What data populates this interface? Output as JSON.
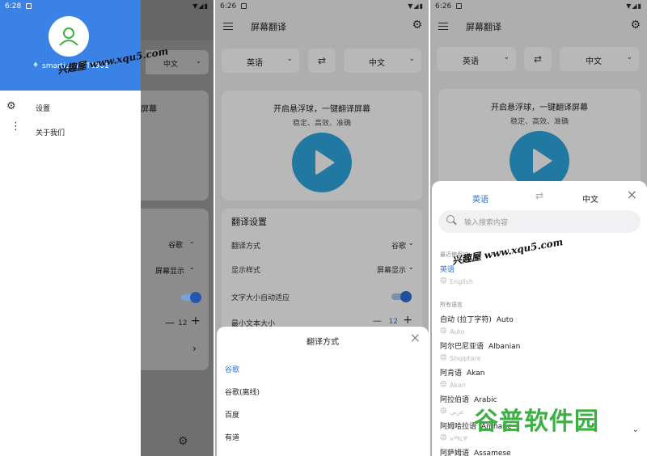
{
  "panel1": {
    "time": "6:28",
    "status_icons": "▼◢▮",
    "drawer": {
      "account_name": "smartisan DT1901",
      "items": [
        {
          "label": "设置",
          "icon": "gear-icon"
        },
        {
          "label": "关于我们",
          "icon": "more-vert-icon"
        }
      ]
    },
    "behind": {
      "lang_target": "中文",
      "card_text": "屏幕",
      "engine_value": "谷歌",
      "style_value": "屏幕显示",
      "min_size": "12"
    }
  },
  "panel2": {
    "time": "6:26",
    "status_icons": "▼◢▮",
    "title": "屏幕翻译",
    "source_lang": "英语",
    "target_lang": "中文",
    "card_title": "开启悬浮球，一键翻译屏幕",
    "card_subtitle": "稳定、高效、准确",
    "settings": {
      "title": "翻译设置",
      "rows": [
        {
          "key": "翻译方式",
          "value": "谷歌"
        },
        {
          "key": "显示样式",
          "value": "屏幕显示"
        }
      ],
      "auto_size_label": "文字大小自动适应",
      "min_size_label": "最小文本大小",
      "min_size_value": "12"
    },
    "sheet": {
      "title": "翻译方式",
      "options": [
        "谷歌",
        "谷歌(离线)",
        "百度",
        "有道"
      ],
      "selected_index": 0
    }
  },
  "panel3": {
    "time": "6:26",
    "status_icons": "▼◢▮",
    "title": "屏幕翻译",
    "source_lang": "英语",
    "target_lang": "中文",
    "card_title": "开启悬浮球，一键翻译屏幕",
    "card_subtitle": "稳定、高效、准确",
    "picker": {
      "tab_source": "英语",
      "tab_target": "中文",
      "search_placeholder": "输入搜索内容",
      "recent_header": "最近使用过",
      "recent": [
        {
          "zh": "英语",
          "native": "English"
        }
      ],
      "all_header": "所有语言",
      "languages": [
        {
          "zh": "自动 (拉丁字符)",
          "en": "Auto",
          "native": "Auto"
        },
        {
          "zh": "阿尔巴尼亚语",
          "en": "Albanian",
          "native": "Shqiptare"
        },
        {
          "zh": "阿肯语",
          "en": "Akan",
          "native": "Akan"
        },
        {
          "zh": "阿拉伯语",
          "en": "Arabic",
          "native": "عربي"
        },
        {
          "zh": "阿姆哈拉语",
          "en": "Amharic",
          "native": "አማርኛ"
        },
        {
          "zh": "阿萨姆语",
          "en": "Assamese",
          "native": ""
        }
      ]
    }
  },
  "watermarks": {
    "url_text": "兴趣屋 www.xqu5.com",
    "logo_text": "谷普软件园"
  },
  "colors": {
    "accent_blue": "#2c6fd6",
    "play_blue": "#2fa8e0",
    "drawer_header": "#3b82e6",
    "logo_green": "#3cb043"
  }
}
